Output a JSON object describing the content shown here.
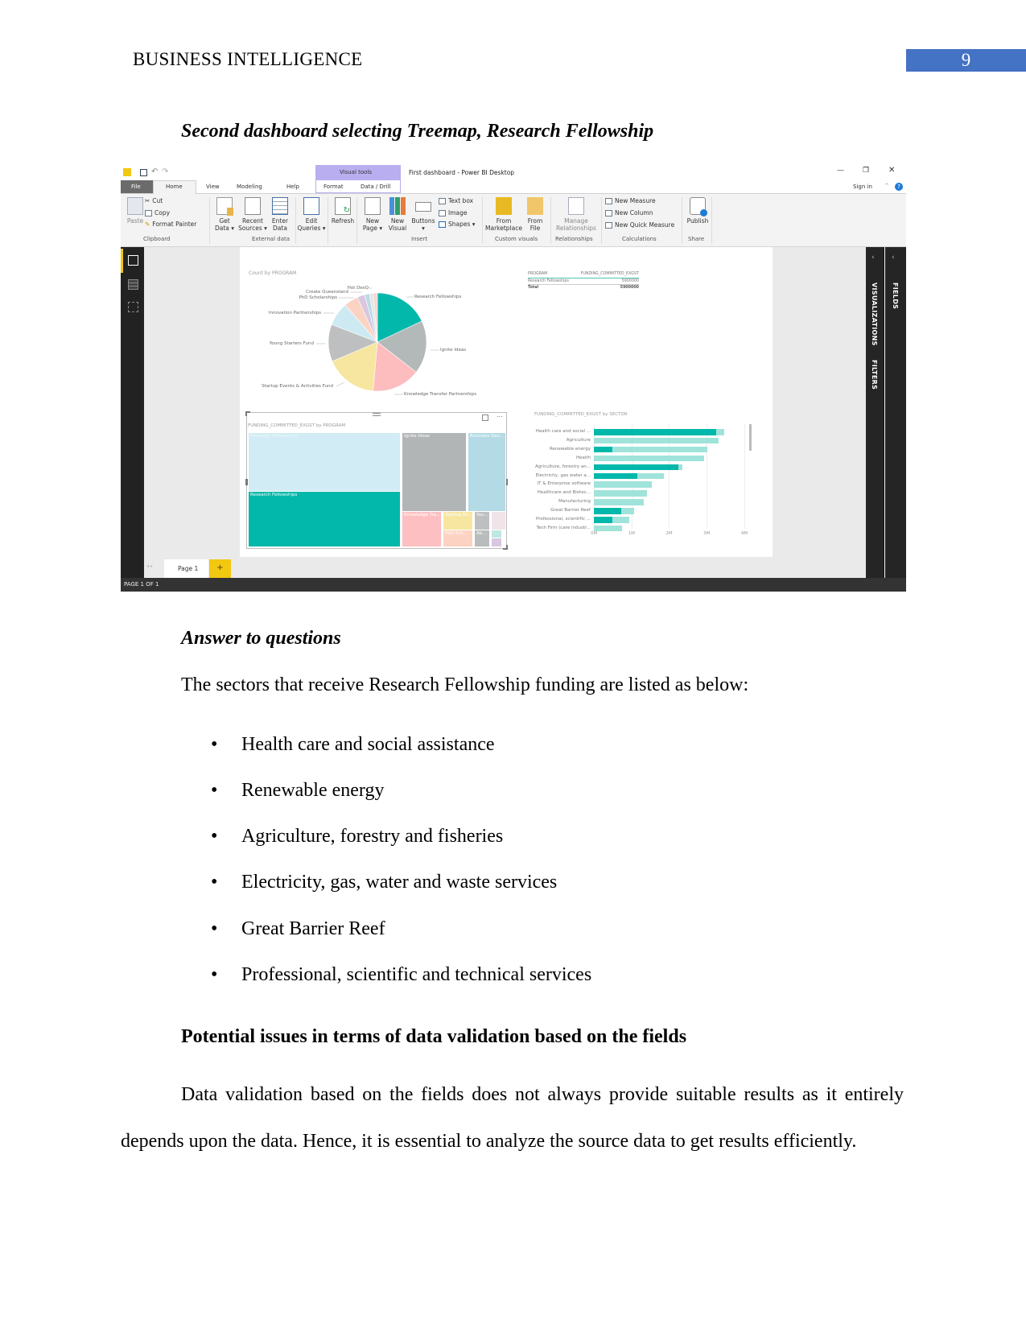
{
  "header": {
    "running_title": "BUSINESS INTELLIGENCE",
    "page_number": "9",
    "accent": "#4472C4"
  },
  "caption": "Second dashboard selecting Treemap, Research Fellowship",
  "app": {
    "window_title": "First dashboard - Power BI Desktop",
    "sign_in": "Sign in",
    "context_tab_group": "Visual tools",
    "tabs": [
      "File",
      "Home",
      "View",
      "Modeling",
      "Help",
      "Format",
      "Data / Drill"
    ],
    "ribbon": {
      "paste": "Paste",
      "cut": "Cut",
      "copy": "Copy",
      "format_painter": "Format Painter",
      "get_data": "Get\nData ▾",
      "recent_sources": "Recent\nSources ▾",
      "enter_data": "Enter\nData",
      "edit_queries": "Edit\nQueries ▾",
      "refresh": "Refresh",
      "new_page": "New\nPage ▾",
      "new_visual": "New\nVisual",
      "buttons": "Buttons\n▾",
      "text_box": "Text box",
      "image": "Image",
      "shapes": "Shapes ▾",
      "from_marketplace": "From\nMarketplace",
      "from_file": "From\nFile",
      "manage_relationships": "Manage\nRelationships",
      "new_measure": "New Measure",
      "new_column": "New Column",
      "new_quick_measure": "New Quick Measure",
      "publish": "Publish",
      "groups": [
        "Clipboard",
        "External data",
        "Insert",
        "Custom visuals",
        "Relationships",
        "Calculations",
        "Share"
      ]
    },
    "side_panes": [
      "VISUALIZATIONS",
      "FILTERS",
      "FIELDS"
    ],
    "page_tab": "Page 1",
    "add_page": "+",
    "status": "PAGE 1 OF 1",
    "table": {
      "headers": [
        "PROGRAM",
        "FUNDING_COMMITTED_EXGST"
      ],
      "rows": [
        [
          "Research Fellowships",
          "5900000"
        ]
      ],
      "total": [
        "Total",
        "5900000"
      ]
    },
    "treemap": {
      "title": "FUNDING_COMMITTED_EXGST by PROGRAM",
      "tiles": [
        "Research Fellowships",
        "Research Fellowships",
        "Ignite Ideas",
        "Business Dev...",
        "Knowledge Tra...",
        "Startup Ev...",
        "PhD Sch...",
        "You...",
        "Ab..."
      ]
    }
  },
  "chart_data": [
    {
      "type": "pie",
      "title": "Count by PROGRAM",
      "unit": "percent of count (estimated)",
      "slices": [
        {
          "label": "Research Fellowships",
          "value": 18.0,
          "color": "#01B8AA"
        },
        {
          "label": "Ignite Ideas",
          "value": 17.5,
          "color": "#B3B8B8"
        },
        {
          "label": "Knowledge Transfer Partnerships",
          "value": 15.9,
          "color": "#FDBCBE"
        },
        {
          "label": "Startup Events & Activities Fund",
          "value": 17.2,
          "color": "#F7E6A0"
        },
        {
          "label": "Young Starters Fund",
          "value": 12.2,
          "color": "#BDBFC0"
        },
        {
          "label": "Innovation Partnerships",
          "value": 7.8,
          "color": "#CDEAF3"
        },
        {
          "label": "PhD Scholarships",
          "value": 4.7,
          "color": "#FCD3C2"
        },
        {
          "label": "Create Queensland",
          "value": 2.5,
          "color": "#D9C6E0"
        },
        {
          "label": "",
          "value": 1.6,
          "color": "#B9DCE7"
        },
        {
          "label": "",
          "value": 1.2,
          "color": "#E5E5E5"
        },
        {
          "label": "Hot DesQ",
          "value": 1.4,
          "color": "#F5D6D6"
        }
      ]
    },
    {
      "type": "bar",
      "orientation": "horizontal",
      "title": "FUNDING_COMMITTED_EXGST by SECTOR",
      "categories": [
        "Health care and social ...",
        "Agriculture",
        "Renewable energy",
        "Health",
        "Agriculture, forestry an...",
        "Electricity, gas water a...",
        "IT & Enterprise software",
        "Healthcare and Biotec...",
        "Manufacturing",
        "Great Barrier Reef",
        "Professional, scientific ...",
        "Tech Firm (care industr..."
      ],
      "series": [
        {
          "role": "total",
          "color": "#A0E3DA",
          "values": [
            3.46,
            3.32,
            3.01,
            2.93,
            2.36,
            1.86,
            1.54,
            1.41,
            1.32,
            1.06,
            0.94,
            0.75
          ]
        },
        {
          "role": "highlighted (Research Fellowships)",
          "color": "#01B8AA",
          "values": [
            3.26,
            0,
            0.49,
            0,
            2.24,
            1.15,
            0,
            0,
            0,
            0.72,
            0.49,
            0
          ]
        }
      ],
      "xticks": [
        "0M",
        "1M",
        "2M",
        "3M",
        "4M"
      ],
      "xlim": [
        0,
        4
      ],
      "x_unit": "M",
      "grid": true
    }
  ],
  "answer_heading": "Answer to questions",
  "answer_intro": "The sectors that receive Research Fellowship funding are listed as below:",
  "bullets": [
    "Health care and social assistance",
    "Renewable energy",
    "Agriculture, forestry and fisheries",
    "Electricity, gas, water and waste services",
    "Great Barrier Reef",
    "Professional, scientific and technical services"
  ],
  "bullet_glyph": "•",
  "issues_heading": "Potential issues in terms of data validation based on the fields",
  "issues_line1": "Data validation based on the fields does not always provide suitable results as it entirely",
  "issues_line2": "depends upon the data. Hence, it is essential to analyze the source data to get results efficiently."
}
